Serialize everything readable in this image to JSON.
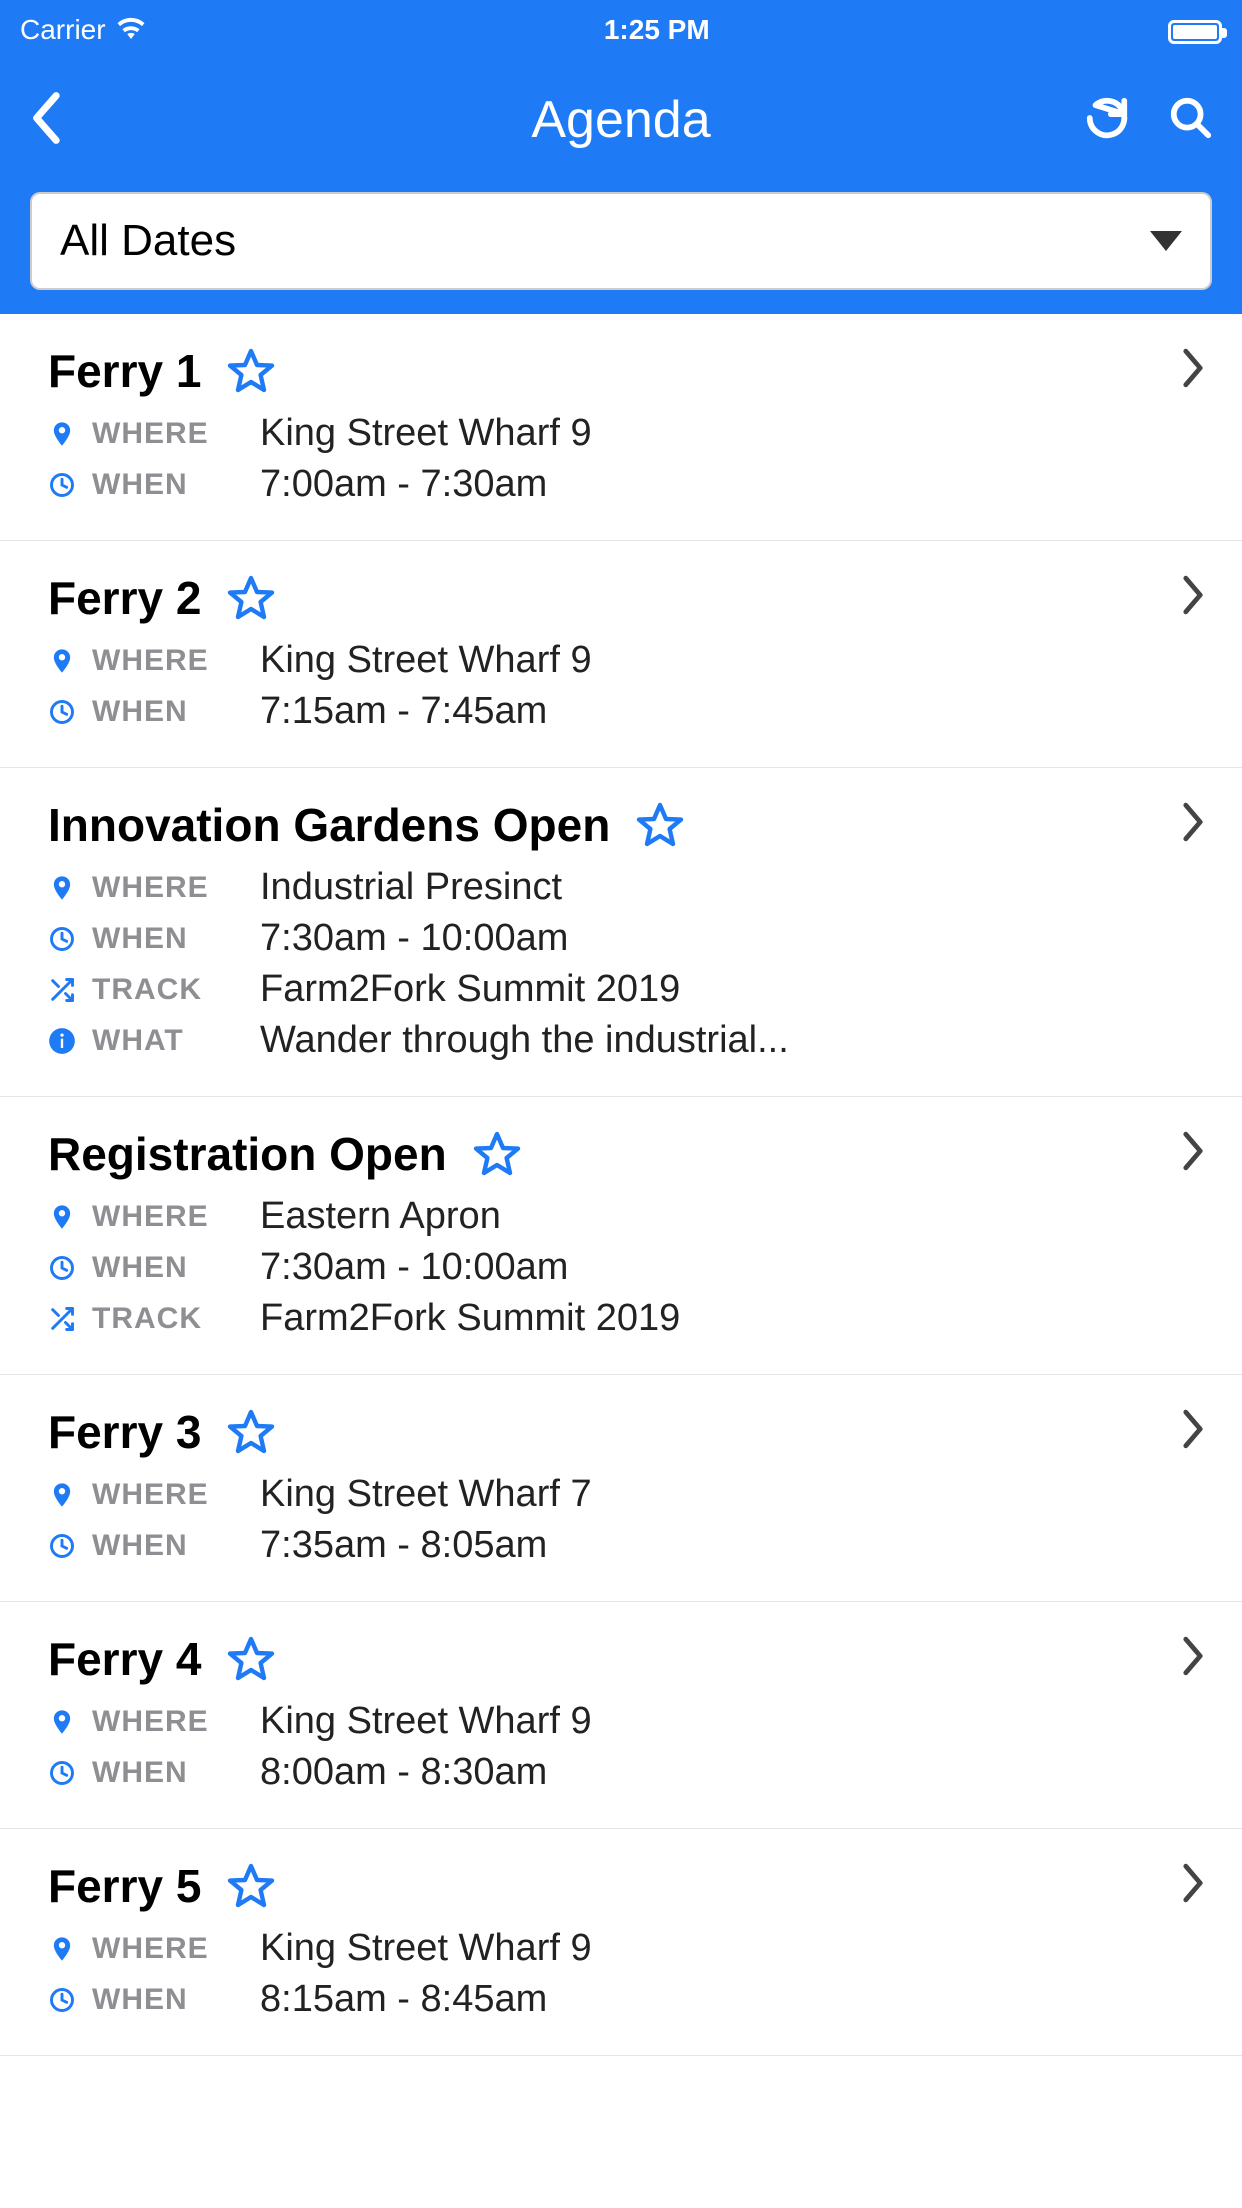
{
  "status": {
    "carrier": "Carrier",
    "time": "1:25 PM"
  },
  "nav": {
    "title": "Agenda"
  },
  "filter": {
    "label": "All Dates"
  },
  "labels": {
    "where": "WHERE",
    "when": "WHEN",
    "track": "TRACK",
    "what": "WHAT"
  },
  "items": [
    {
      "title": "Ferry 1",
      "where": "King Street Wharf 9",
      "when": "7:00am - 7:30am"
    },
    {
      "title": "Ferry 2",
      "where": "King Street Wharf 9",
      "when": "7:15am - 7:45am"
    },
    {
      "title": "Innovation Gardens Open",
      "where": "Industrial Presinct",
      "when": "7:30am - 10:00am",
      "track": "Farm2Fork Summit 2019",
      "what": "Wander through the industrial..."
    },
    {
      "title": "Registration Open",
      "where": "Eastern Apron",
      "when": "7:30am - 10:00am",
      "track": "Farm2Fork Summit 2019"
    },
    {
      "title": "Ferry 3",
      "where": "King Street Wharf 7",
      "when": "7:35am - 8:05am"
    },
    {
      "title": "Ferry 4",
      "where": "King Street Wharf 9",
      "when": "8:00am - 8:30am"
    },
    {
      "title": "Ferry 5",
      "where": "King Street Wharf 9",
      "when": "8:15am - 8:45am"
    }
  ]
}
